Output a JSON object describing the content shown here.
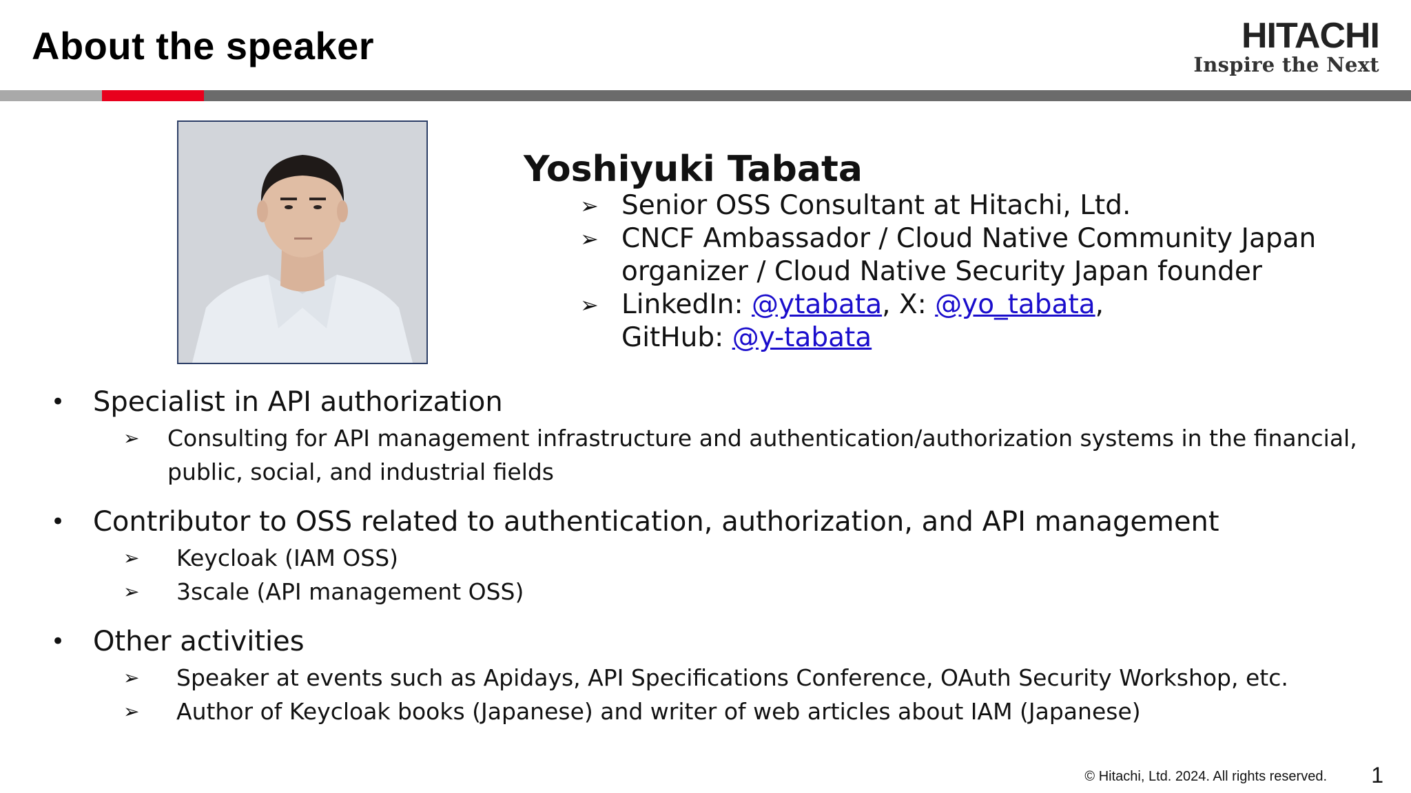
{
  "header": {
    "title": "About the speaker",
    "logo_wordmark": "HITACHI",
    "logo_tagline": "Inspire the Next"
  },
  "speaker": {
    "name": "Yoshiyuki Tabata",
    "photo_icon": "speaker-portrait",
    "details": [
      {
        "text": "Senior OSS Consultant at Hitachi, Ltd."
      },
      {
        "text": "CNCF Ambassador / Cloud Native Community Japan organizer / Cloud Native Security Japan founder"
      }
    ],
    "social": {
      "linkedin_label": "LinkedIn: ",
      "linkedin_handle": "@ytabata",
      "x_label": ", X: ",
      "x_handle": "@yo_tabata",
      "github_label": ",",
      "github_prefix": "GitHub: ",
      "github_handle": "@y-tabata"
    }
  },
  "sections": [
    {
      "heading": "Specialist in API authorization",
      "items": [
        "Consulting for API management infrastructure and authentication/authorization systems in the financial, public, social, and industrial fields"
      ]
    },
    {
      "heading": "Contributor to OSS related to authentication, authorization, and API management",
      "items": [
        "Keycloak (IAM OSS)",
        "3scale (API management OSS)"
      ]
    },
    {
      "heading": "Other activities",
      "items": [
        "Speaker at events such as Apidays, API Specifications Conference, OAuth Security Workshop, etc.",
        "Author of Keycloak books (Japanese) and writer of web articles about IAM (Japanese)"
      ]
    }
  ],
  "symbols": {
    "arrow": "➢",
    "bullet": "•"
  },
  "footer": {
    "copyright": "© Hitachi, Ltd. 2024. All rights reserved.",
    "page_number": "1"
  },
  "colors": {
    "accent": "#e8001c",
    "link": "#1a0dcc",
    "rule": "#6b6b6b"
  }
}
